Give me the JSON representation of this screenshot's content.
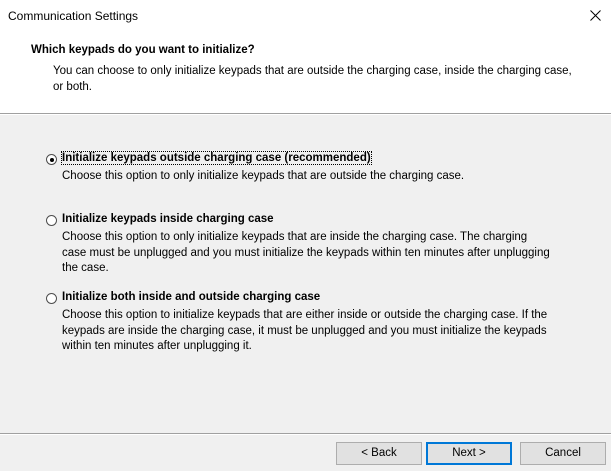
{
  "window": {
    "title": "Communication Settings",
    "close_glyph": "✕"
  },
  "header": {
    "title": "Which keypads do you want to initialize?",
    "subtitle": "You can choose to only initialize keypads that are outside the charging case, inside the charging case, or both."
  },
  "options": [
    {
      "label": "Initialize keypads outside charging case (recommended)",
      "description": "Choose this option to only initialize keypads that are outside the charging case.",
      "selected": true
    },
    {
      "label": "Initialize keypads inside charging case",
      "description": "Choose this option to only initialize keypads that are inside the charging case. The charging case must be unplugged and you must initialize the keypads within ten minutes after unplugging the case.",
      "selected": false
    },
    {
      "label": "Initialize both inside and outside charging case",
      "description": "Choose this option to initialize keypads that are either inside or outside the charging case. If the keypads are inside the charging case, it must be unplugged and you must initialize the keypads within ten minutes after unplugging it.",
      "selected": false
    }
  ],
  "buttons": {
    "back": "< Back",
    "next": "Next >",
    "cancel": "Cancel"
  },
  "colors": {
    "accent": "#0078d7",
    "window_bg": "#f0f0f0",
    "header_bg": "#ffffff"
  }
}
